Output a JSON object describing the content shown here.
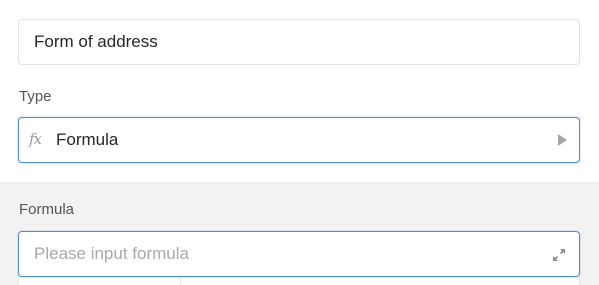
{
  "name_field": {
    "value": "Form of address"
  },
  "type_field": {
    "label": "Type",
    "icon": "fx-icon",
    "value": "Formula",
    "caret_icon": "caret-right-icon"
  },
  "formula_field": {
    "label": "Formula",
    "placeholder": "Please input formula",
    "expand_icon": "expand-icon"
  },
  "colors": {
    "focus_border": "#4a90d9",
    "section_background": "#f2f2f2",
    "border": "#e2e2e2"
  }
}
